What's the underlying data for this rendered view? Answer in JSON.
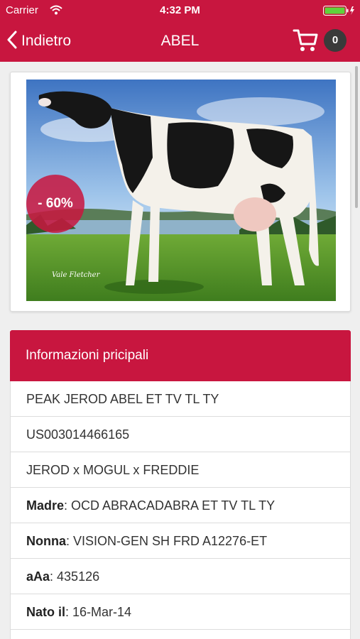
{
  "status_bar": {
    "carrier": "Carrier",
    "time": "4:32 PM"
  },
  "nav": {
    "back_label": "Indietro",
    "title": "ABEL",
    "cart_count": "0"
  },
  "product": {
    "image_icon": "cow-photo",
    "image_caption": "Vale Fletcher",
    "discount": "- 60%"
  },
  "info": {
    "header": "Informazioni pricipali",
    "rows": [
      {
        "value": "PEAK JEROD ABEL ET TV TL TY"
      },
      {
        "value": "US003014466165"
      },
      {
        "value": "JEROD x MOGUL x FREDDIE"
      },
      {
        "key": "Madre",
        "value": ": OCD ABRACADABRA ET TV TL TY"
      },
      {
        "key": "Nonna",
        "value": ": VISION-GEN SH FRD A12276-ET"
      },
      {
        "key": "aAa",
        "value": ": 435126"
      },
      {
        "key": "Nato il",
        "value": ": 16-Mar-14"
      }
    ]
  },
  "colors": {
    "accent": "#c8163f",
    "background": "#efefef",
    "badge": "#3a3a3a"
  }
}
